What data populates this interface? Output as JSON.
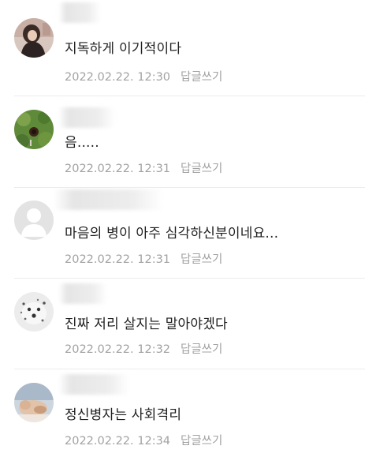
{
  "comments": [
    {
      "text": "지독하게 이기적이다",
      "date": "2022.02.22. 12:30",
      "reply_label": "답글쓰기",
      "avatar": "photo-person-icon"
    },
    {
      "text": "음.....",
      "date": "2022.02.22. 12:31",
      "reply_label": "답글쓰기",
      "avatar": "photo-green-icon"
    },
    {
      "text": "마음의 병이 아주 심각하신분이네요...",
      "date": "2022.02.22. 12:31",
      "reply_label": "답글쓰기",
      "avatar": "default-user-icon"
    },
    {
      "text": "진짜 저리 살지는 말아야겠다",
      "date": "2022.02.22. 12:32",
      "reply_label": "답글쓰기",
      "avatar": "photo-dalmatian-icon"
    },
    {
      "text": "정신병자는 사회격리",
      "date": "2022.02.22. 12:34",
      "reply_label": "답글쓰기",
      "avatar": "photo-cat-icon"
    }
  ],
  "colors": {
    "text": "#1f1f1f",
    "meta": "#a2a2a2",
    "divider": "#ececec"
  }
}
